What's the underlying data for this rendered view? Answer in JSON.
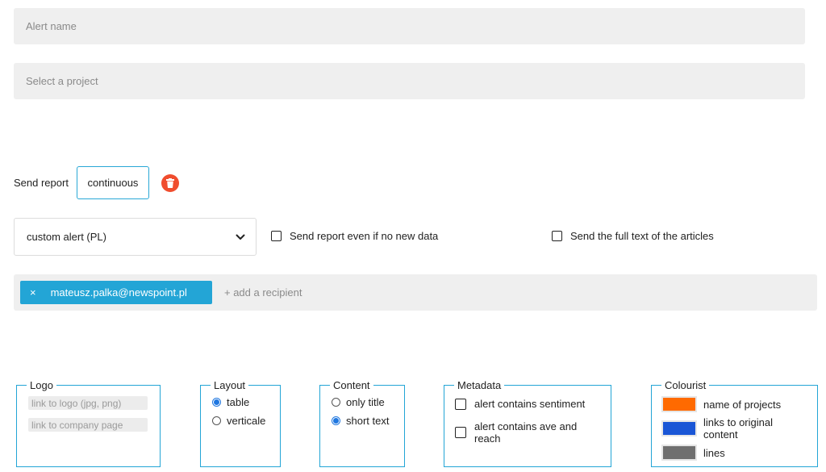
{
  "form": {
    "alert_name_placeholder": "Alert name",
    "project_placeholder": "Select a project"
  },
  "report": {
    "send_label": "Send report",
    "frequency": "continuous",
    "template_selected": "custom alert (PL)",
    "no_new_data_label": "Send report even if no new data",
    "full_text_label": "Send the full text of the articles"
  },
  "recipients": {
    "items": [
      "mateusz.palka@newspoint.pl"
    ],
    "remove_symbol": "×",
    "add_label": "+ add a recipient"
  },
  "logo": {
    "legend": "Logo",
    "logo_link_placeholder": "link to logo (jpg, png)",
    "company_link_placeholder": "link to company page"
  },
  "layout": {
    "legend": "Layout",
    "options": [
      "table",
      "verticale"
    ],
    "selected": "table"
  },
  "content": {
    "legend": "Content",
    "options": [
      "only title",
      "short text"
    ],
    "selected": "short text"
  },
  "metadata": {
    "legend": "Metadata",
    "options": [
      "alert contains sentiment",
      "alert contains ave and reach"
    ]
  },
  "colourist": {
    "legend": "Colourist",
    "items": [
      {
        "label": "name of projects",
        "color": "#ff6a00"
      },
      {
        "label": "links to original content",
        "color": "#1a56d6"
      },
      {
        "label": "lines",
        "color": "#6f6f6f"
      }
    ]
  },
  "colors": {
    "accent": "#23a5d6",
    "delete": "#f04d2e",
    "radio": "#1f77e0"
  }
}
